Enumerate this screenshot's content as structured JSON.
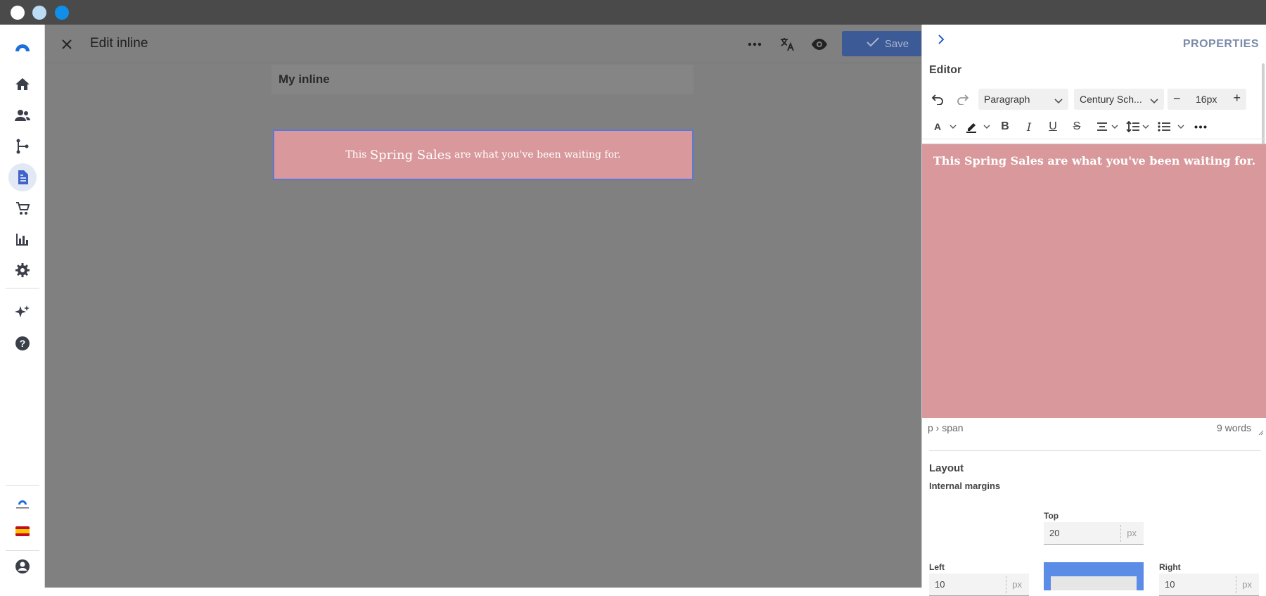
{
  "window": {
    "title": "Edit inline"
  },
  "header": {
    "save_label": "Save"
  },
  "sidebar": {
    "items": [
      "home-icon",
      "people-icon",
      "flow-icon",
      "document-icon",
      "cart-icon",
      "chart-icon",
      "gear-icon",
      "sparkle-icon",
      "help-icon"
    ],
    "brand_small": "CONNECTIF",
    "flag": "es"
  },
  "canvas": {
    "inline_name": "My inline",
    "preview": {
      "pre": "This ",
      "highlight": "Spring Sales",
      "post": " are what you've been waiting for."
    }
  },
  "panel": {
    "title": "PROPERTIES",
    "editor_label": "Editor",
    "block_format": "Paragraph",
    "font_family": "Century Sch...",
    "font_size": "16px",
    "content": "This Spring Sales are what you've been waiting for.",
    "path": "p › span",
    "word_count": "9 words",
    "layout_label": "Layout",
    "internal_margins_label": "Internal margins",
    "margins": {
      "top_label": "Top",
      "top_value": "20",
      "left_label": "Left",
      "left_value": "10",
      "right_label": "Right",
      "right_value": "10",
      "unit": "px"
    }
  },
  "colors": {
    "accent": "#3c5a96",
    "content_bg": "#d9989b",
    "selection_border": "#5b78d6"
  }
}
